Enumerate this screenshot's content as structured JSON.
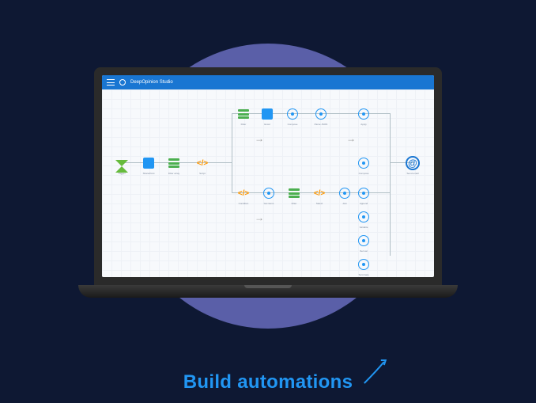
{
  "app": {
    "title": "DeepOpinion Studio"
  },
  "caption": {
    "text": "Build automations"
  },
  "colors": {
    "background": "#0e1833",
    "circle": "#5a5fa8",
    "accent": "#2196f3",
    "titlebar": "#1976d2"
  },
  "workflow": {
    "nodes": [
      {
        "id": "n1",
        "type": "trigger",
        "icon": "hourglass",
        "label": "Trigger"
      },
      {
        "id": "n2",
        "type": "action",
        "icon": "blue-square",
        "label": "SharePoint"
      },
      {
        "id": "n3",
        "type": "filter",
        "icon": "green-bars",
        "label": "Filter array"
      },
      {
        "id": "n4",
        "type": "code",
        "icon": "code",
        "label": "Script"
      },
      {
        "id": "n5",
        "type": "filter",
        "icon": "green-bars",
        "label": "Filter"
      },
      {
        "id": "n6",
        "type": "action",
        "icon": "blue-square",
        "label": "Excel"
      },
      {
        "id": "n7",
        "type": "step",
        "icon": "circle",
        "label": "Compose"
      },
      {
        "id": "n8",
        "type": "step",
        "icon": "circle",
        "label": "Parse JSON"
      },
      {
        "id": "n9",
        "type": "step",
        "icon": "circle",
        "label": "Apply"
      },
      {
        "id": "n10",
        "type": "next",
        "icon": "arrow",
        "label": ""
      },
      {
        "id": "n11",
        "type": "next",
        "icon": "arrow",
        "label": ""
      },
      {
        "id": "n12",
        "type": "code",
        "icon": "code",
        "label": "Condition"
      },
      {
        "id": "n13",
        "type": "step",
        "icon": "circle",
        "label": "Get items"
      },
      {
        "id": "n14",
        "type": "filter",
        "icon": "green-bars",
        "label": "Filter"
      },
      {
        "id": "n15",
        "type": "code",
        "icon": "code",
        "label": "Select"
      },
      {
        "id": "n16",
        "type": "step",
        "icon": "circle",
        "label": "Join"
      },
      {
        "id": "n17",
        "type": "step",
        "icon": "circle",
        "label": "Compose"
      },
      {
        "id": "n18",
        "type": "step",
        "icon": "circle",
        "label": "Append"
      },
      {
        "id": "n19",
        "type": "step",
        "icon": "circle",
        "label": "Variable"
      },
      {
        "id": "n20",
        "type": "step",
        "icon": "circle",
        "label": "Set var"
      },
      {
        "id": "n21",
        "type": "step",
        "icon": "circle",
        "label": "Terminate"
      },
      {
        "id": "n22",
        "type": "email",
        "icon": "at",
        "label": "Send email"
      }
    ]
  }
}
